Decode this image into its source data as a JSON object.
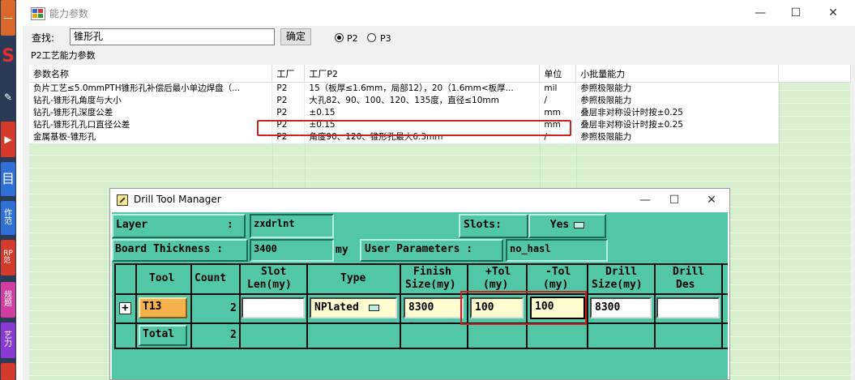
{
  "main_window": {
    "title": "能力参数",
    "search": {
      "label": "查找:",
      "value": "锥形孔",
      "confirm_label": "确定"
    },
    "radios": [
      {
        "label": "P2",
        "checked": true
      },
      {
        "label": "P3",
        "checked": false
      }
    ],
    "group_label": "P2工艺能力参数",
    "columns": [
      "参数名称",
      "工厂",
      "工厂P2",
      "单位",
      "小批量能力"
    ],
    "rows": [
      [
        "负片工艺≤5.0mmPTH锥形孔补偿后最小单边焊盘（...",
        "P2",
        "15（板厚≤1.6mm，局部12），20（1.6mm<板厚...",
        "mil",
        "参照极限能力"
      ],
      [
        "钻孔-锥形孔角度与大小",
        "P2",
        "大孔82、90、100、120、135度，直径≤10mm",
        "/",
        "参照极限能力"
      ],
      [
        "钻孔-锥形孔深度公差",
        "P2",
        "±0.15",
        "mm",
        "叠层非对称设计时按±0.25"
      ],
      [
        "钻孔-锥形孔孔口直径公差",
        "P2",
        "±0.15",
        "mm",
        "叠层非对称设计时按±0.25"
      ],
      [
        "金属基板-锥形孔",
        "P2",
        "角度90、120、锥形孔最大6.3mm",
        "/",
        "参照极限能力"
      ]
    ]
  },
  "dialog": {
    "title": "Drill Tool Manager",
    "layer_label": "Layer",
    "layer_colon": ":",
    "layer_value": "zxdrlnt",
    "slots_label": "Slots:",
    "slots_value": "Yes",
    "board_thickness_label": "Board Thickness :",
    "board_thickness_value": "3400",
    "board_thickness_unit": "my",
    "user_params_label": "User Parameters :",
    "user_params_value": "no_hasl",
    "columns": {
      "tool": "Tool",
      "count": "Count",
      "slot_len": [
        "Slot",
        "Len(my)"
      ],
      "type": "Type",
      "finish_size": [
        "Finish",
        "Size(my)"
      ],
      "plus_tol": [
        "+Tol",
        "(my)"
      ],
      "minus_tol": [
        "-Tol",
        "(my)"
      ],
      "drill_size": [
        "Drill",
        "Size(my)"
      ],
      "drill_des": [
        "Drill",
        "Des"
      ]
    },
    "rows": [
      {
        "expand": "+",
        "tool": "T13",
        "count": "2",
        "slot_len": "",
        "type": "NPlated",
        "finish_size": "8300",
        "plus_tol": "100",
        "minus_tol": "100",
        "drill_size": "8300",
        "drill_des": ""
      }
    ],
    "total_label": "Total",
    "total_count": "2"
  },
  "taskbar": {
    "items": [
      {
        "icon": "minus-icon",
        "color": "#d9672a",
        "text": "—"
      },
      {
        "icon": "s-icon",
        "color": "#2b3a55",
        "text": "S"
      },
      {
        "icon": "tool-icon",
        "color": "#2b3a55",
        "text": "✎"
      },
      {
        "icon": "red-app-icon",
        "color": "#d53a2a",
        "text": "▶"
      },
      {
        "icon": "blue-app-icon",
        "color": "#2f6fd6",
        "text": "目"
      },
      {
        "icon": "work-app-icon",
        "color": "#2f6fd6",
        "text": "作范"
      },
      {
        "icon": "rp-app-icon",
        "color": "#d53a2a",
        "text": "RP范"
      },
      {
        "icon": "rule-app-icon",
        "color": "#d23ea0",
        "text": "规题"
      },
      {
        "icon": "craft-app-icon",
        "color": "#8a3ad2",
        "text": "艺力"
      },
      {
        "icon": "red-bottom-icon",
        "color": "#d53a2a",
        "text": ""
      }
    ]
  }
}
